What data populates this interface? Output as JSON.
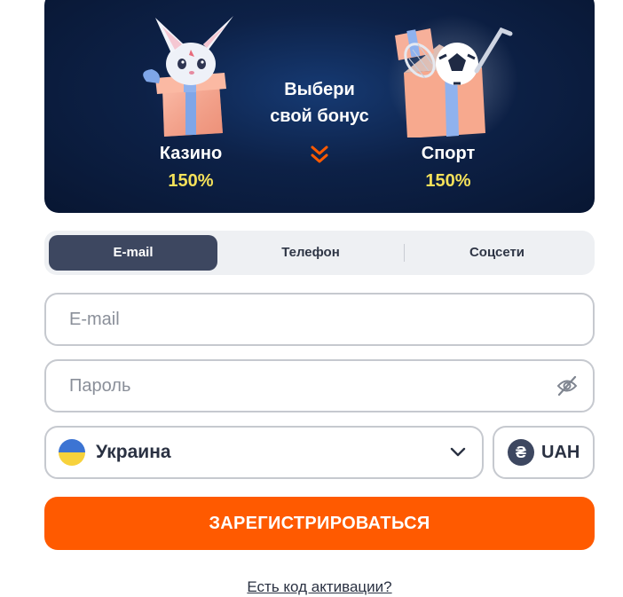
{
  "banner": {
    "center_line1": "Выбери",
    "center_line2": "свой бонус",
    "casino": {
      "title": "Казино",
      "percent": "150%",
      "icon": "gift-fox-icon"
    },
    "sport": {
      "title": "Спорт",
      "percent": "150%",
      "icon": "gift-ball-icon"
    },
    "chevron_icon": "double-chevron-down-icon",
    "colors": {
      "accent_percent": "#f5e15a",
      "chevron": "#ff5a00",
      "background": "#0d2147"
    }
  },
  "tabs": [
    {
      "label": "E-mail",
      "active": true
    },
    {
      "label": "Телефон",
      "active": false
    },
    {
      "label": "Соцсети",
      "active": false
    }
  ],
  "form": {
    "email_placeholder": "E-mail",
    "password_placeholder": "Пароль",
    "password_icon": "eye-off-icon",
    "country": {
      "label": "Украина",
      "flag": "ukraine-flag-icon"
    },
    "currency": {
      "symbol": "₴",
      "label": "UAH"
    },
    "register_label": "ЗАРЕГИСТРИРОВАТЬСЯ",
    "activation_link": "Есть код активации?"
  },
  "colors": {
    "primary": "#ff5a00",
    "tab_active": "#3d4760",
    "border": "#c6c9cf"
  }
}
